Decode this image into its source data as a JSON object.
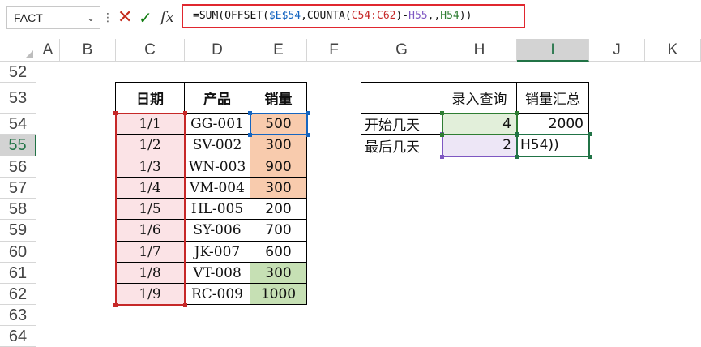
{
  "formula_bar": {
    "name_box": "FACT",
    "formula_parts": [
      "=SUM(OFFSET(",
      "$E$54",
      ",COUNTA(",
      "C54:C62",
      ")-",
      "H55",
      ",,",
      "H54",
      "))"
    ]
  },
  "columns": [
    "A",
    "B",
    "C",
    "D",
    "E",
    "F",
    "G",
    "H",
    "I",
    "J",
    "K"
  ],
  "rows": [
    "52",
    "53",
    "54",
    "55",
    "56",
    "57",
    "58",
    "59",
    "60",
    "61",
    "62",
    "63",
    "64"
  ],
  "table1": {
    "headers": [
      "日期",
      "产品",
      "销量"
    ],
    "rows": [
      [
        "1/1",
        "GG-001",
        "500"
      ],
      [
        "1/2",
        "SV-002",
        "300"
      ],
      [
        "1/3",
        "WN-003",
        "900"
      ],
      [
        "1/4",
        "VM-004",
        "300"
      ],
      [
        "1/5",
        "HL-005",
        "200"
      ],
      [
        "1/6",
        "SY-006",
        "700"
      ],
      [
        "1/7",
        "JK-007",
        "600"
      ],
      [
        "1/8",
        "VT-008",
        "300"
      ],
      [
        "1/9",
        "RC-009",
        "1000"
      ]
    ]
  },
  "table2": {
    "headers": [
      "",
      "录入查询",
      "销量汇总"
    ],
    "rows": [
      [
        "开始几天",
        "4",
        "2000"
      ],
      [
        "最后几天",
        "2",
        "H54))"
      ]
    ]
  },
  "colors": {
    "ref_blue": "#1565c0",
    "ref_red": "#c62828",
    "ref_purple": "#7e57c2",
    "ref_green": "#2e7d32",
    "highlight_border": "#e0272f"
  }
}
